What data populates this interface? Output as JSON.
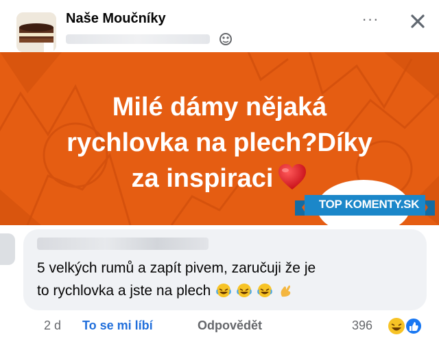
{
  "post": {
    "group_name": "Naše Moučníky",
    "image_text_line1": "Milé dámy nějaká",
    "image_text_line2": "rychlovka na plech?Díky",
    "image_text_line3": "za inspiraci",
    "more_label": "···"
  },
  "watermark": {
    "text": "TOP KOMENTY.SK"
  },
  "comment": {
    "text_line1": "5 velkých rumů a zapít pivem, zaručuji že je",
    "text_line2": "to rychlovka a jste na plech",
    "time": "2 d",
    "like_label": "To se mi líbí",
    "reply_label": "Odpovědět",
    "reaction_count": "396"
  },
  "colors": {
    "orange": "#e55d12",
    "link_blue": "#216fdb",
    "bubble": "#f0f2f5",
    "watermark_blue": "#1b87c9"
  },
  "icons": [
    "group-avatar",
    "globe-icon",
    "more-icon",
    "close-icon",
    "heart-icon",
    "laughing-emoji-icon",
    "hand-emoji-icon",
    "haha-reaction-icon",
    "like-reaction-icon"
  ]
}
